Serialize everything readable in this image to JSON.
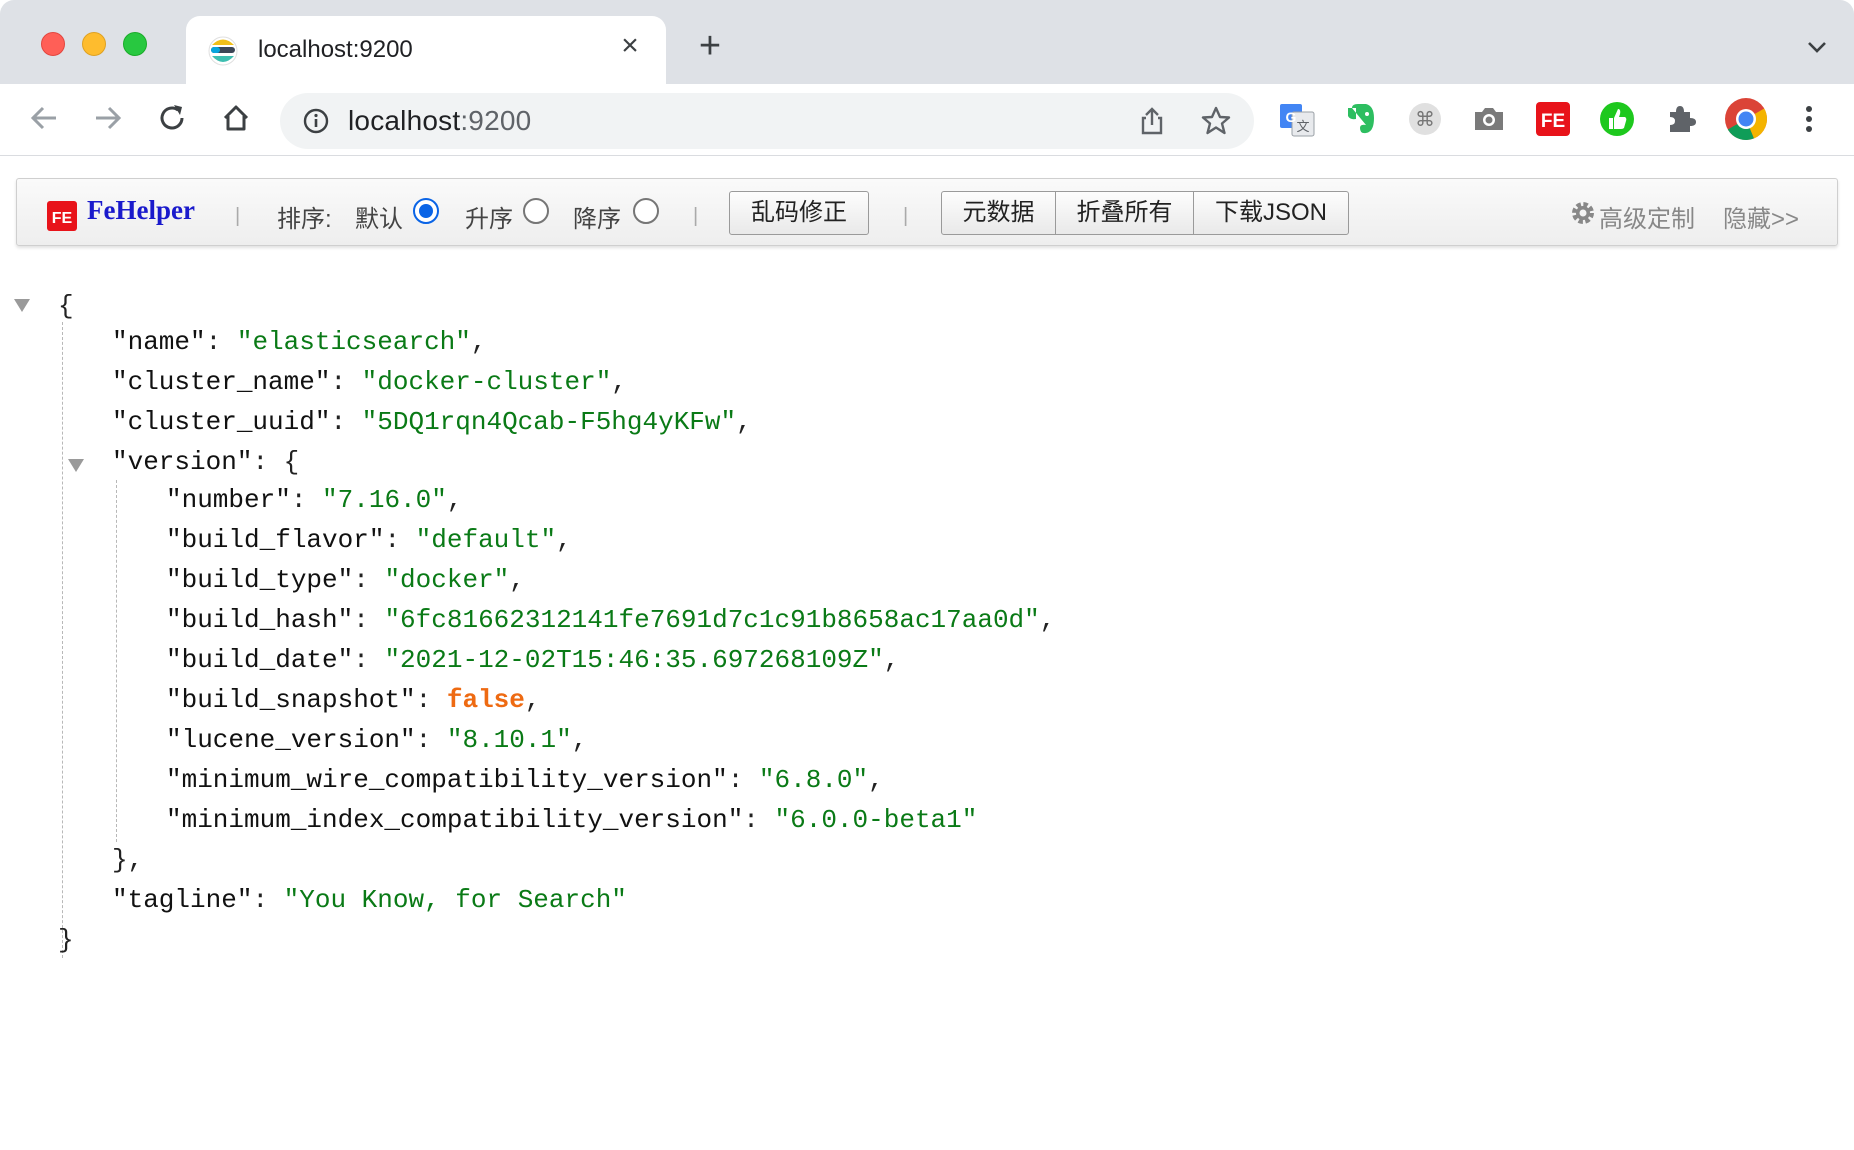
{
  "browser": {
    "tab_title": "localhost:9200",
    "new_tab_symbol": "+",
    "close_symbol": "×",
    "url_host": "localhost",
    "url_port": ":9200",
    "extensions": [
      "google-translate-icon",
      "evernote-icon",
      "command-icon",
      "camera-icon",
      "fehelper-icon",
      "thumbs-up-icon",
      "puzzle-extensions-icon",
      "chrome-profile-icon",
      "more-menu-icon"
    ]
  },
  "fehelper": {
    "brand": "FeHelper",
    "sort_label": "排序:",
    "sort_default": "默认",
    "sort_asc": "升序",
    "sort_desc": "降序",
    "sort_selected": "默认",
    "fix_encoding": "乱码修正",
    "metadata": "元数据",
    "collapse_all": "折叠所有",
    "download_json": "下载JSON",
    "advanced": "高级定制",
    "hide": "隐藏>>",
    "separator": "|"
  },
  "json": {
    "open_brace": "{",
    "close_brace": "}",
    "version_close": "},",
    "lines": [
      {
        "key": "\"name\"",
        "value": "\"elasticsearch\"",
        "tail": ","
      },
      {
        "key": "\"cluster_name\"",
        "value": "\"docker-cluster\"",
        "tail": ","
      },
      {
        "key": "\"cluster_uuid\"",
        "value": "\"5DQ1rqn4Qcab-F5hg4yKFw\"",
        "tail": ","
      },
      {
        "key": "\"version\"",
        "value": "{",
        "tail": ""
      },
      {
        "key": "\"number\"",
        "value": "\"7.16.0\"",
        "tail": ","
      },
      {
        "key": "\"build_flavor\"",
        "value": "\"default\"",
        "tail": ","
      },
      {
        "key": "\"build_type\"",
        "value": "\"docker\"",
        "tail": ","
      },
      {
        "key": "\"build_hash\"",
        "value": "\"6fc81662312141fe7691d7c1c91b8658ac17aa0d\"",
        "tail": ","
      },
      {
        "key": "\"build_date\"",
        "value": "\"2021-12-02T15:46:35.697268109Z\"",
        "tail": ","
      },
      {
        "key": "\"build_snapshot\"",
        "value": "false",
        "tail": ","
      },
      {
        "key": "\"lucene_version\"",
        "value": "\"8.10.1\"",
        "tail": ","
      },
      {
        "key": "\"minimum_wire_compatibility_version\"",
        "value": "\"6.8.0\"",
        "tail": ","
      },
      {
        "key": "\"minimum_index_compatibility_version\"",
        "value": "\"6.0.0-beta1\"",
        "tail": ""
      },
      {
        "key": "\"tagline\"",
        "value": "\"You Know, for Search\"",
        "tail": ""
      }
    ]
  }
}
